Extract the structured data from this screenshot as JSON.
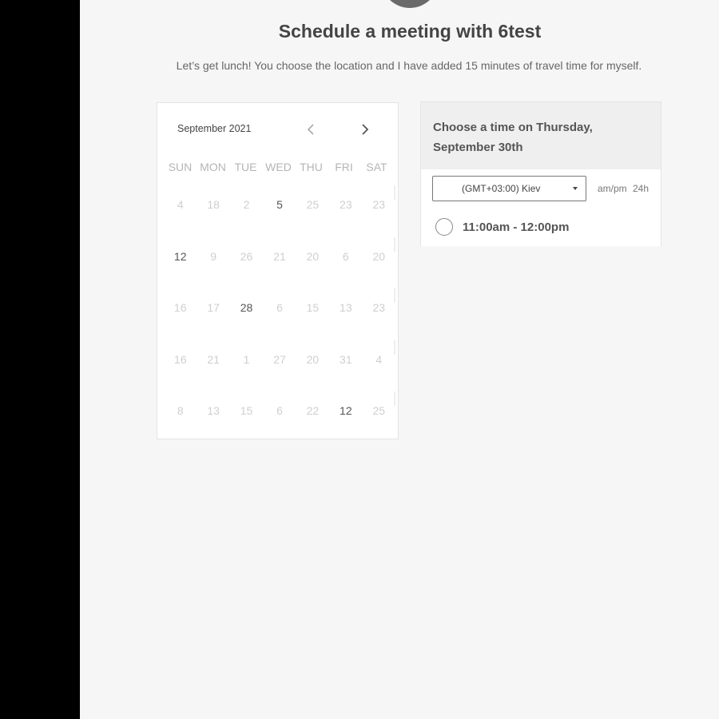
{
  "header": {
    "title": "Schedule a meeting with 6test",
    "subtitle": "Let’s get lunch! You choose the location and I have added 15 minutes of travel time for myself."
  },
  "calendar": {
    "month_label": "September 2021",
    "prev_icon": "chevron-left-icon",
    "next_icon": "chevron-right-icon",
    "weekdays": [
      "SUN",
      "MON",
      "TUE",
      "WED",
      "THU",
      "FRI",
      "SAT"
    ],
    "weeks": [
      [
        "4",
        "18",
        "2",
        "5",
        "25",
        "23",
        "23"
      ],
      [
        "12",
        "9",
        "26",
        "21",
        "20",
        "6",
        "20"
      ],
      [
        "16",
        "17",
        "28",
        "6",
        "15",
        "13",
        "23"
      ],
      [
        "16",
        "21",
        "1",
        "27",
        "20",
        "31",
        "4"
      ],
      [
        "8",
        "13",
        "15",
        "6",
        "22",
        "12",
        "25"
      ]
    ],
    "active_days": [
      [
        0,
        3
      ],
      [
        1,
        0
      ],
      [
        2,
        2
      ],
      [
        4,
        5
      ]
    ]
  },
  "times": {
    "heading": "Choose a time on Thursday, September 30th",
    "timezone": "(GMT+03:00) Kiev",
    "format_ampm": "am/pm",
    "format_24h": "24h",
    "slots": [
      "11:00am - 12:00pm"
    ]
  },
  "colors": {
    "page_bg": "#f6f6f6",
    "side_bar": "#000000",
    "card_bg": "#ffffff",
    "header_bg": "#efefef"
  }
}
